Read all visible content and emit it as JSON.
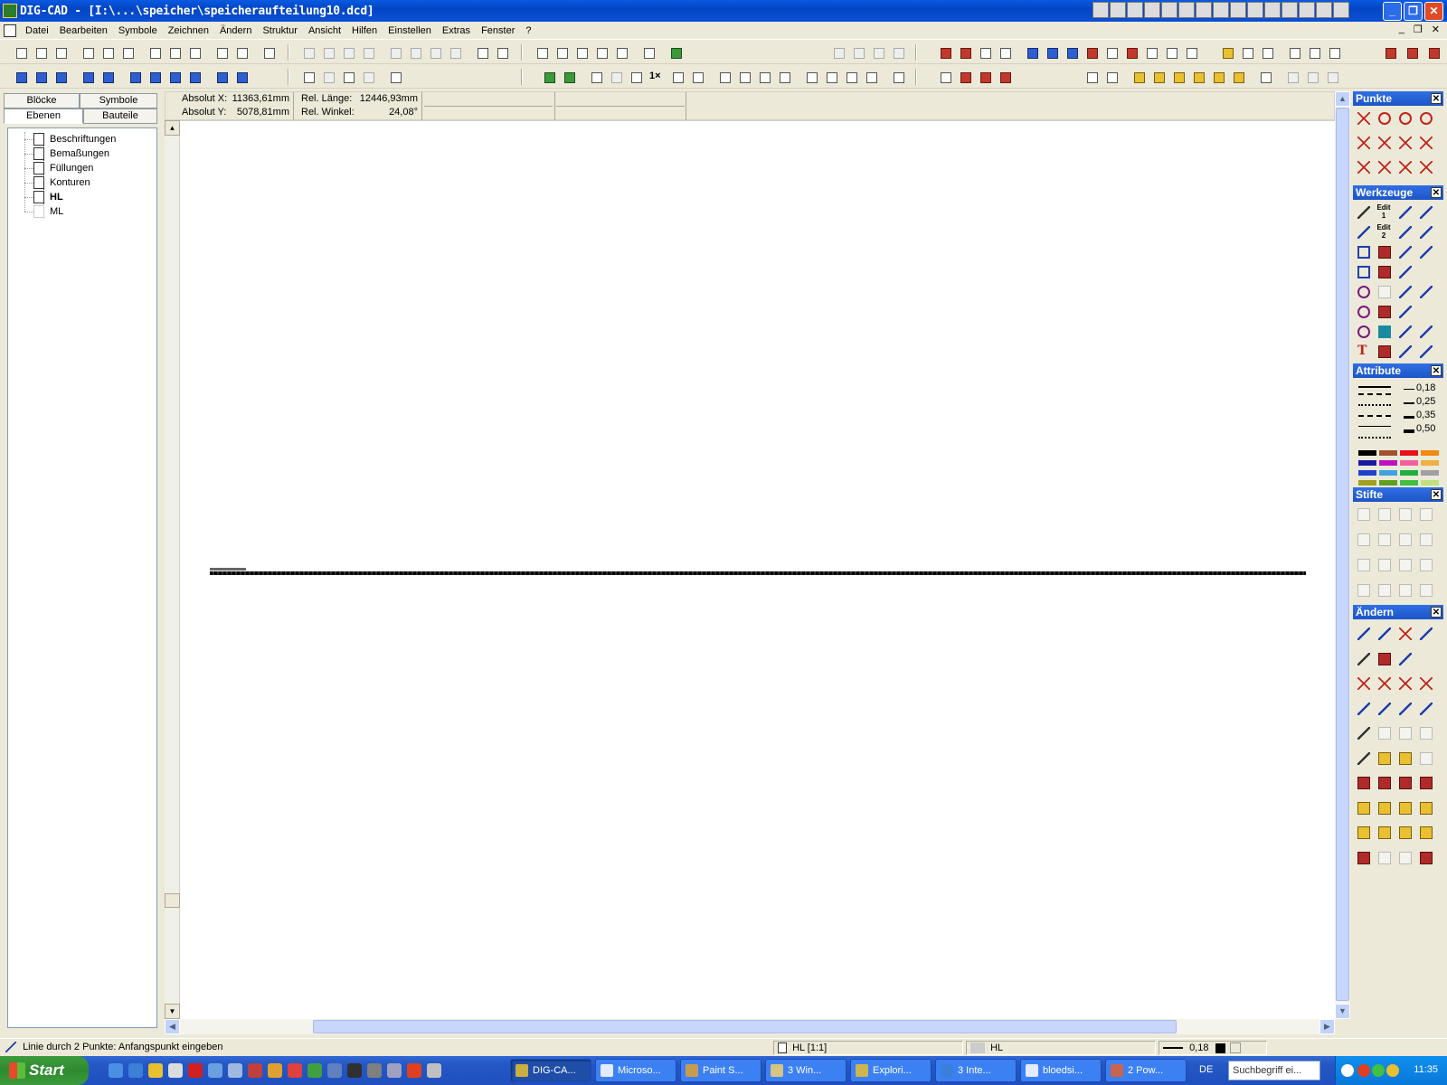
{
  "window": {
    "title": "DIG-CAD - [I:\\...\\speicher\\speicheraufteilung10.dcd]"
  },
  "menu": {
    "items": [
      "Datei",
      "Bearbeiten",
      "Symbole",
      "Zeichnen",
      "Ändern",
      "Struktur",
      "Ansicht",
      "Hilfen",
      "Einstellen",
      "Extras",
      "Fenster",
      "?"
    ]
  },
  "toolbar": {
    "zoom_1x_label": "1×"
  },
  "left_panel": {
    "tabs": [
      "Blöcke",
      "Symbole",
      "Ebenen",
      "Bauteile"
    ],
    "active_tab": "Ebenen",
    "layers": [
      {
        "name": "Beschriftungen",
        "bold": false
      },
      {
        "name": "Bemaßungen",
        "bold": false
      },
      {
        "name": "Füllungen",
        "bold": false
      },
      {
        "name": "Konturen",
        "bold": false
      },
      {
        "name": "HL",
        "bold": true
      },
      {
        "name": "ML",
        "bold": false
      }
    ]
  },
  "coords": {
    "abs_x_label": "Absolut X:",
    "abs_x_value": "11363,61mm",
    "abs_y_label": "Absolut Y:",
    "abs_y_value": "5078,81mm",
    "rel_len_label": "Rel. Länge:",
    "rel_len_value": "12446,93mm",
    "rel_angle_label": "Rel. Winkel:",
    "rel_angle_value": "24,08°"
  },
  "palettes": {
    "punkte": "Punkte",
    "werkzeuge": "Werkzeuge",
    "attribute": "Attribute",
    "stifte": "Stifte",
    "aendern": "Ändern",
    "line_weights": [
      "0,18",
      "0,25",
      "0,35",
      "0,50"
    ],
    "colors": [
      "#000000",
      "#a0522d",
      "#e8101a",
      "#f08a10",
      "#1a1aa0",
      "#c010c0",
      "#f060a0",
      "#f0b040",
      "#2040d0",
      "#40a0e0",
      "#20b040",
      "#a0a0a0",
      "#a0a020",
      "#60a020",
      "#40c040",
      "#c0e080"
    ],
    "edit_labels": [
      "Edit 1",
      "Edit 2"
    ]
  },
  "statusbar": {
    "message": "Linie durch 2 Punkte: Anfangspunkt eingeben",
    "layer": "HL [1:1]",
    "pen_layer": "HL",
    "line_weight": "0,18"
  },
  "taskbar": {
    "start": "Start",
    "tasks": [
      "DIG-CA...",
      "Microso...",
      "Paint S...",
      "3 Win...",
      "Explori...",
      "3 Inte...",
      "bloedsi...",
      "2 Pow..."
    ],
    "active_task": "DIG-CA...",
    "language": "DE",
    "search_placeholder": "Suchbegriff ei...",
    "clock": "11:35"
  }
}
